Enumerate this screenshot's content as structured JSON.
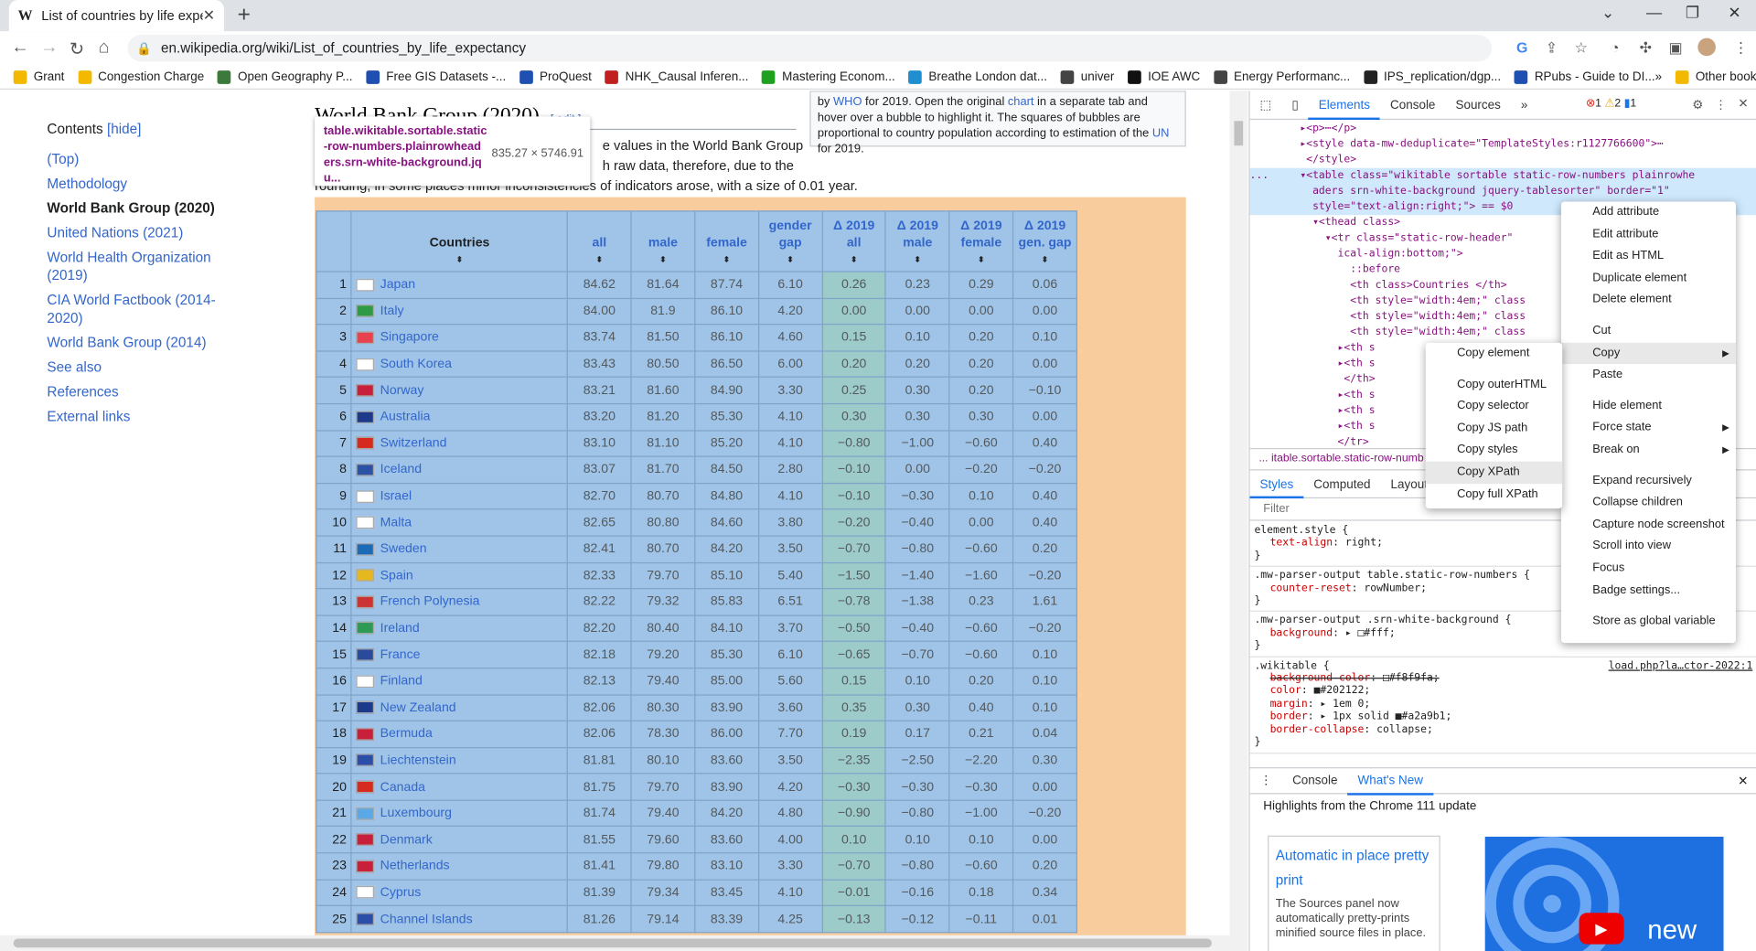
{
  "browser": {
    "tab_title": "List of countries by life expectanc",
    "tab_icon": "W",
    "url": "en.wikipedia.org/wiki/List_of_countries_by_life_expectancy",
    "bookmarks": [
      "Grant",
      "Congestion Charge",
      "Open Geography P...",
      "Free GIS Datasets -...",
      "ProQuest",
      "NHK_Causal Inferen...",
      "Mastering Econom...",
      "Breathe London dat...",
      "univer",
      "IOE AWC",
      "Energy Performanc...",
      "IPS_replication/dgp...",
      "RPubs - Guide to DI..."
    ],
    "bookmarks_overflow": "»",
    "other_bookmarks": "Other bookmarks",
    "bookmark_colors": [
      "#f2b900",
      "#f2b900",
      "#3c7a3c",
      "#1f4fb0",
      "#1f4fb0",
      "#c02020",
      "#20a020",
      "#1f8fd0",
      "#444",
      "#111",
      "#444",
      "#222",
      "#1f4fb0"
    ]
  },
  "toc": {
    "title": "Contents",
    "hide": "[hide]",
    "items": [
      "(Top)",
      "Methodology",
      "World Bank Group (2020)",
      "United Nations (2021)",
      "World Health Organization (2019)",
      "CIA World Factbook (2014-2020)",
      "World Bank Group (2014)",
      "See also",
      "References",
      "External links"
    ]
  },
  "article": {
    "heading": "World Bank Group (2020)",
    "edit": "[ edit ]",
    "para_line1": "e values in the World Bank Group",
    "para_line2": "h raw data, therefore, due to the",
    "para_line3": "rounding, in some places minor inconsistencies of indicators arose, with a size of 0.01 year.",
    "infobox_pre": "by ",
    "infobox_who": "WHO",
    "infobox_mid": " for 2019. Open the original ",
    "infobox_chart": "chart",
    "infobox_rest": " in a separate tab and hover over a bubble to highlight it. The squares of bubbles are proportional to country population according to estimation of the ",
    "infobox_un": "UN",
    "infobox_end": " for 2019."
  },
  "inspect_tooltip": {
    "selector": "table.wikitable.sortable.static-row-numbers.plainrowheaders.srn-white-background.jqu...",
    "size": "835.27 × 5746.91"
  },
  "table": {
    "headers": [
      "Countries",
      "all",
      "male",
      "female",
      "gender gap",
      "Δ 2019 all",
      "Δ 2019 male",
      "Δ 2019 female",
      "Δ 2019 gen. gap"
    ],
    "sort_arrow": "⬍",
    "rows": [
      [
        "1",
        "Japan",
        "84.62",
        "81.64",
        "87.74",
        "6.10",
        "0.26",
        "0.23",
        "0.29",
        "0.06"
      ],
      [
        "2",
        "Italy",
        "84.00",
        "81.9",
        "86.10",
        "4.20",
        "0.00",
        "0.00",
        "0.00",
        "0.00"
      ],
      [
        "3",
        "Singapore",
        "83.74",
        "81.50",
        "86.10",
        "4.60",
        "0.15",
        "0.10",
        "0.20",
        "0.10"
      ],
      [
        "4",
        "South Korea",
        "83.43",
        "80.50",
        "86.50",
        "6.00",
        "0.20",
        "0.20",
        "0.20",
        "0.00"
      ],
      [
        "5",
        "Norway",
        "83.21",
        "81.60",
        "84.90",
        "3.30",
        "0.25",
        "0.30",
        "0.20",
        "−0.10"
      ],
      [
        "6",
        "Australia",
        "83.20",
        "81.20",
        "85.30",
        "4.10",
        "0.30",
        "0.30",
        "0.30",
        "0.00"
      ],
      [
        "7",
        "Switzerland",
        "83.10",
        "81.10",
        "85.20",
        "4.10",
        "−0.80",
        "−1.00",
        "−0.60",
        "0.40"
      ],
      [
        "8",
        "Iceland",
        "83.07",
        "81.70",
        "84.50",
        "2.80",
        "−0.10",
        "0.00",
        "−0.20",
        "−0.20"
      ],
      [
        "9",
        "Israel",
        "82.70",
        "80.70",
        "84.80",
        "4.10",
        "−0.10",
        "−0.30",
        "0.10",
        "0.40"
      ],
      [
        "10",
        "Malta",
        "82.65",
        "80.80",
        "84.60",
        "3.80",
        "−0.20",
        "−0.40",
        "0.00",
        "0.40"
      ],
      [
        "11",
        "Sweden",
        "82.41",
        "80.70",
        "84.20",
        "3.50",
        "−0.70",
        "−0.80",
        "−0.60",
        "0.20"
      ],
      [
        "12",
        "Spain",
        "82.33",
        "79.70",
        "85.10",
        "5.40",
        "−1.50",
        "−1.40",
        "−1.60",
        "−0.20"
      ],
      [
        "13",
        "French Polynesia",
        "82.22",
        "79.32",
        "85.83",
        "6.51",
        "−0.78",
        "−1.38",
        "0.23",
        "1.61"
      ],
      [
        "14",
        "Ireland",
        "82.20",
        "80.40",
        "84.10",
        "3.70",
        "−0.50",
        "−0.40",
        "−0.60",
        "−0.20"
      ],
      [
        "15",
        "France",
        "82.18",
        "79.20",
        "85.30",
        "6.10",
        "−0.65",
        "−0.70",
        "−0.60",
        "0.10"
      ],
      [
        "16",
        "Finland",
        "82.13",
        "79.40",
        "85.00",
        "5.60",
        "0.15",
        "0.10",
        "0.20",
        "0.10"
      ],
      [
        "17",
        "New Zealand",
        "82.06",
        "80.30",
        "83.90",
        "3.60",
        "0.35",
        "0.30",
        "0.40",
        "0.10"
      ],
      [
        "18",
        "Bermuda",
        "82.06",
        "78.30",
        "86.00",
        "7.70",
        "0.19",
        "0.17",
        "0.21",
        "0.04"
      ],
      [
        "19",
        "Liechtenstein",
        "81.81",
        "80.10",
        "83.60",
        "3.50",
        "−2.35",
        "−2.50",
        "−2.20",
        "0.30"
      ],
      [
        "20",
        "Canada",
        "81.75",
        "79.70",
        "83.90",
        "4.20",
        "−0.30",
        "−0.30",
        "−0.30",
        "0.00"
      ],
      [
        "21",
        "Luxembourg",
        "81.74",
        "79.40",
        "84.20",
        "4.80",
        "−0.90",
        "−0.80",
        "−1.00",
        "−0.20"
      ],
      [
        "22",
        "Denmark",
        "81.55",
        "79.60",
        "83.60",
        "4.00",
        "0.10",
        "0.10",
        "0.10",
        "0.00"
      ],
      [
        "23",
        "Netherlands",
        "81.41",
        "79.80",
        "83.10",
        "3.30",
        "−0.70",
        "−0.80",
        "−0.60",
        "0.20"
      ],
      [
        "24",
        "Cyprus",
        "81.39",
        "79.34",
        "83.45",
        "4.10",
        "−0.01",
        "−0.16",
        "0.18",
        "0.34"
      ],
      [
        "25",
        "Channel Islands",
        "81.26",
        "79.14",
        "83.39",
        "4.25",
        "−0.13",
        "−0.12",
        "−0.11",
        "0.01"
      ]
    ],
    "flag_colors": [
      "#ffffff",
      "#2e9a45",
      "#e8424f",
      "#ffffff",
      "#c8203a",
      "#1b3a8c",
      "#d52b1e",
      "#2c53a3",
      "#ffffff",
      "#ffffff",
      "#1c6bb8",
      "#e6b820",
      "#cc3333",
      "#2d9b55",
      "#2a4b9c",
      "#ffffff",
      "#1b3a8c",
      "#c8203a",
      "#2b4fa8",
      "#d52b1e",
      "#5aa9e6",
      "#c8203a",
      "#c8203a",
      "#ffffff",
      "#2b4fa8"
    ]
  },
  "devtools": {
    "tabs": [
      "Elements",
      "Console",
      "Sources",
      "»"
    ],
    "active_tab": "Elements",
    "errors": "1",
    "warnings": "2",
    "messages": "1",
    "dom_lines": [
      "        ▸<p>⋯</p>",
      "        ▸<style data-mw-deduplicate=\"TemplateStyles:r1127766600\">⋯",
      "         </style>",
      "...     ▾<table class=\"wikitable sortable static-row-numbers plainrowhe",
      "          aders srn-white-background jquery-tablesorter\" border=\"1\"",
      "          style=\"text-align:right;\"> == $0",
      "          ▾<thead class>",
      "            ▾<tr class=\"static-row-header\" ",
      "              ical-align:bottom;\">",
      "                ::before",
      "                <th class>Countries </th>",
      "                <th style=\"width:4em;\" class",
      "                <th style=\"width:4em;\" class",
      "                <th style=\"width:4em;\" class",
      "              ▸<th s",
      "              ▸<th s",
      "               </th>",
      "              ▸<th s",
      "              ▸<th s",
      "              ▸<th s",
      "              </tr>"
    ],
    "breadcrumb": "...  itable.sortable.static-row-numb",
    "style_tabs": [
      "Styles",
      "Computed",
      "Layout"
    ],
    "filter_placeholder": "Filter",
    "styles": [
      {
        "selector": "element.style {",
        "source": "",
        "props": [
          [
            "text-align",
            "right;"
          ]
        ]
      },
      {
        "selector": ".mw-parser-output table.static-row-numbers {",
        "source": "",
        "props": [
          [
            "counter-reset",
            "rowNumber;"
          ]
        ]
      },
      {
        "selector": ".mw-parser-output .srn-white-background {",
        "source": "",
        "props": [
          [
            "background",
            "▸ □#fff;"
          ]
        ]
      },
      {
        "selector": ".wikitable {",
        "source": "load.php?la…ctor-2022:1",
        "props": [
          [
            "background-color",
            "□#f8f9fa;"
          ],
          [
            "color",
            "■#202122;"
          ],
          [
            "margin",
            "▸ 1em 0;"
          ],
          [
            "border",
            "▸ 1px solid ■#a2a9b1;"
          ],
          [
            "border-collapse",
            "collapse;"
          ]
        ]
      }
    ],
    "drawer_tabs": [
      "Console",
      "What's New"
    ],
    "drawer_headline": "Highlights from the Chrome 111 update",
    "card_title": "Automatic in place pretty print",
    "card_body": "The Sources panel now automatically pretty-prints minified source files in place.",
    "video_text": "new"
  },
  "context_menu": {
    "items": [
      "Add attribute",
      "Edit attribute",
      "Edit as HTML",
      "Duplicate element",
      "Delete element",
      "",
      "Cut",
      "Copy",
      "Paste",
      "",
      "Hide element",
      "Force state",
      "Break on",
      "",
      "Expand recursively",
      "Collapse children",
      "Capture node screenshot",
      "Scroll into view",
      "Focus",
      "Badge settings...",
      "",
      "Store as global variable"
    ],
    "copy_submenu": [
      "Copy element",
      "",
      "Copy outerHTML",
      "Copy selector",
      "Copy JS path",
      "Copy styles",
      "Copy XPath",
      "Copy full XPath"
    ],
    "submenu_arrow": "▶"
  }
}
